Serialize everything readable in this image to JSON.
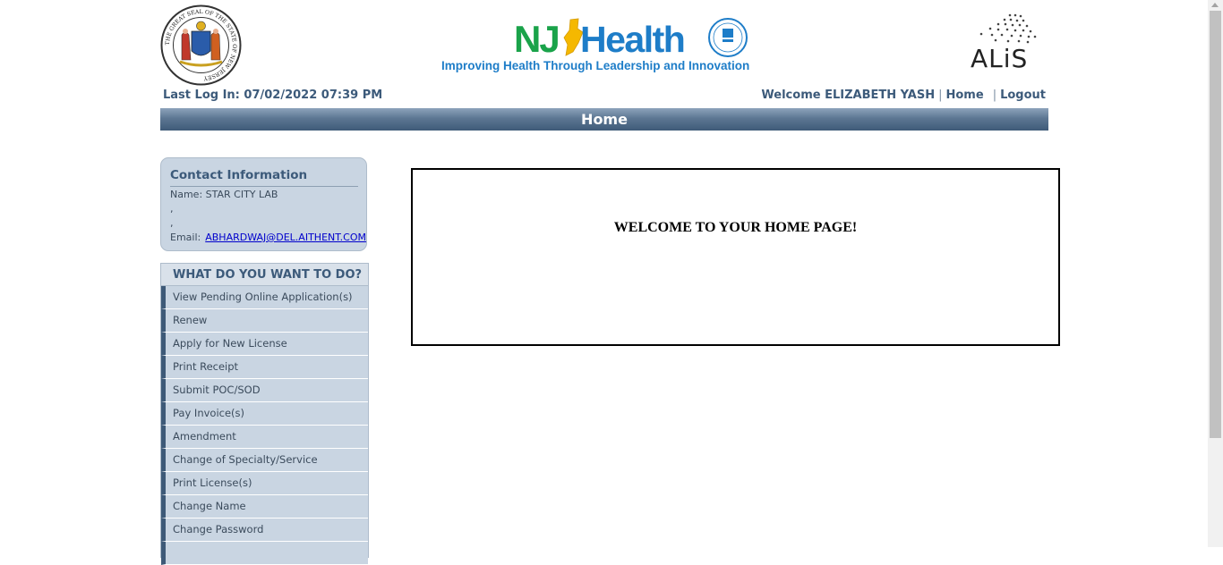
{
  "header": {
    "tagline": "Improving Health Through Leadership and Innovation",
    "nj_brand_nj": "NJ",
    "nj_brand_health": "Health",
    "alis_text": "ALiS",
    "seal_text": "THE GREAT SEAL OF THE STATE OF NEW JERSEY"
  },
  "session": {
    "last_login": "Last Log In: 07/02/2022 07:39 PM",
    "welcome": "Welcome ELIZABETH YASH",
    "home_link": "Home",
    "logout_link": "Logout"
  },
  "page_title": "Home",
  "contact": {
    "heading": "Contact Information",
    "name": "Name: STAR CITY LAB",
    "line2": ",",
    "line3": ",",
    "email_label": "Email:",
    "email": "ABHARDWAJ@DEL.AITHENT.COM"
  },
  "menu": {
    "heading": "WHAT DO YOU WANT TO DO?",
    "items": [
      "View Pending Online Application(s)",
      "Renew",
      "Apply for New License",
      "Print Receipt",
      "Submit POC/SOD",
      "Pay Invoice(s)",
      "Amendment",
      "Change of Specialty/Service",
      "Print License(s)",
      "Change Name",
      "Change Password",
      ""
    ]
  },
  "main": {
    "welcome_message": "WELCOME TO YOUR HOME PAGE!"
  },
  "colors": {
    "nav_text": "#3c5a7a",
    "title_bar": "#5d7793",
    "panel_bg": "#c9d5e2",
    "nj_green": "#1aa34a",
    "health_blue": "#1e7dc8"
  }
}
